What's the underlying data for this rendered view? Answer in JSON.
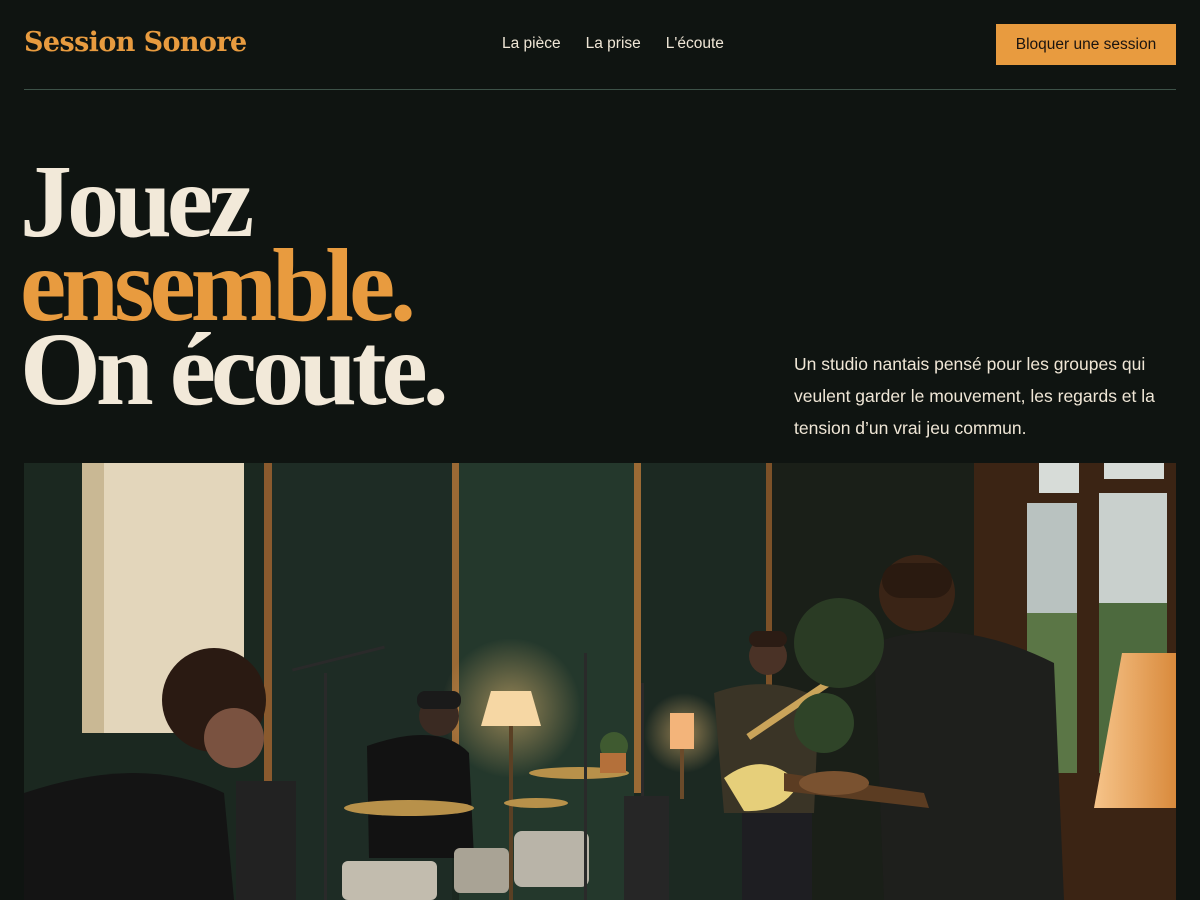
{
  "header": {
    "brand": "Session Sonore",
    "nav": [
      {
        "label": "La pièce"
      },
      {
        "label": "La prise"
      },
      {
        "label": "L'écoute"
      }
    ],
    "cta_label": "Bloquer une session"
  },
  "hero": {
    "line1": "Jouez",
    "line2": "ensemble.",
    "line3": "On écoute.",
    "lede": "Un studio nantais pensé pour les groupes qui veulent garder le mouvement, les regards et la tension d’un vrai jeu commun."
  },
  "colors": {
    "background": "#0f1411",
    "accent": "#e89b3f",
    "text": "#efe6d6"
  }
}
